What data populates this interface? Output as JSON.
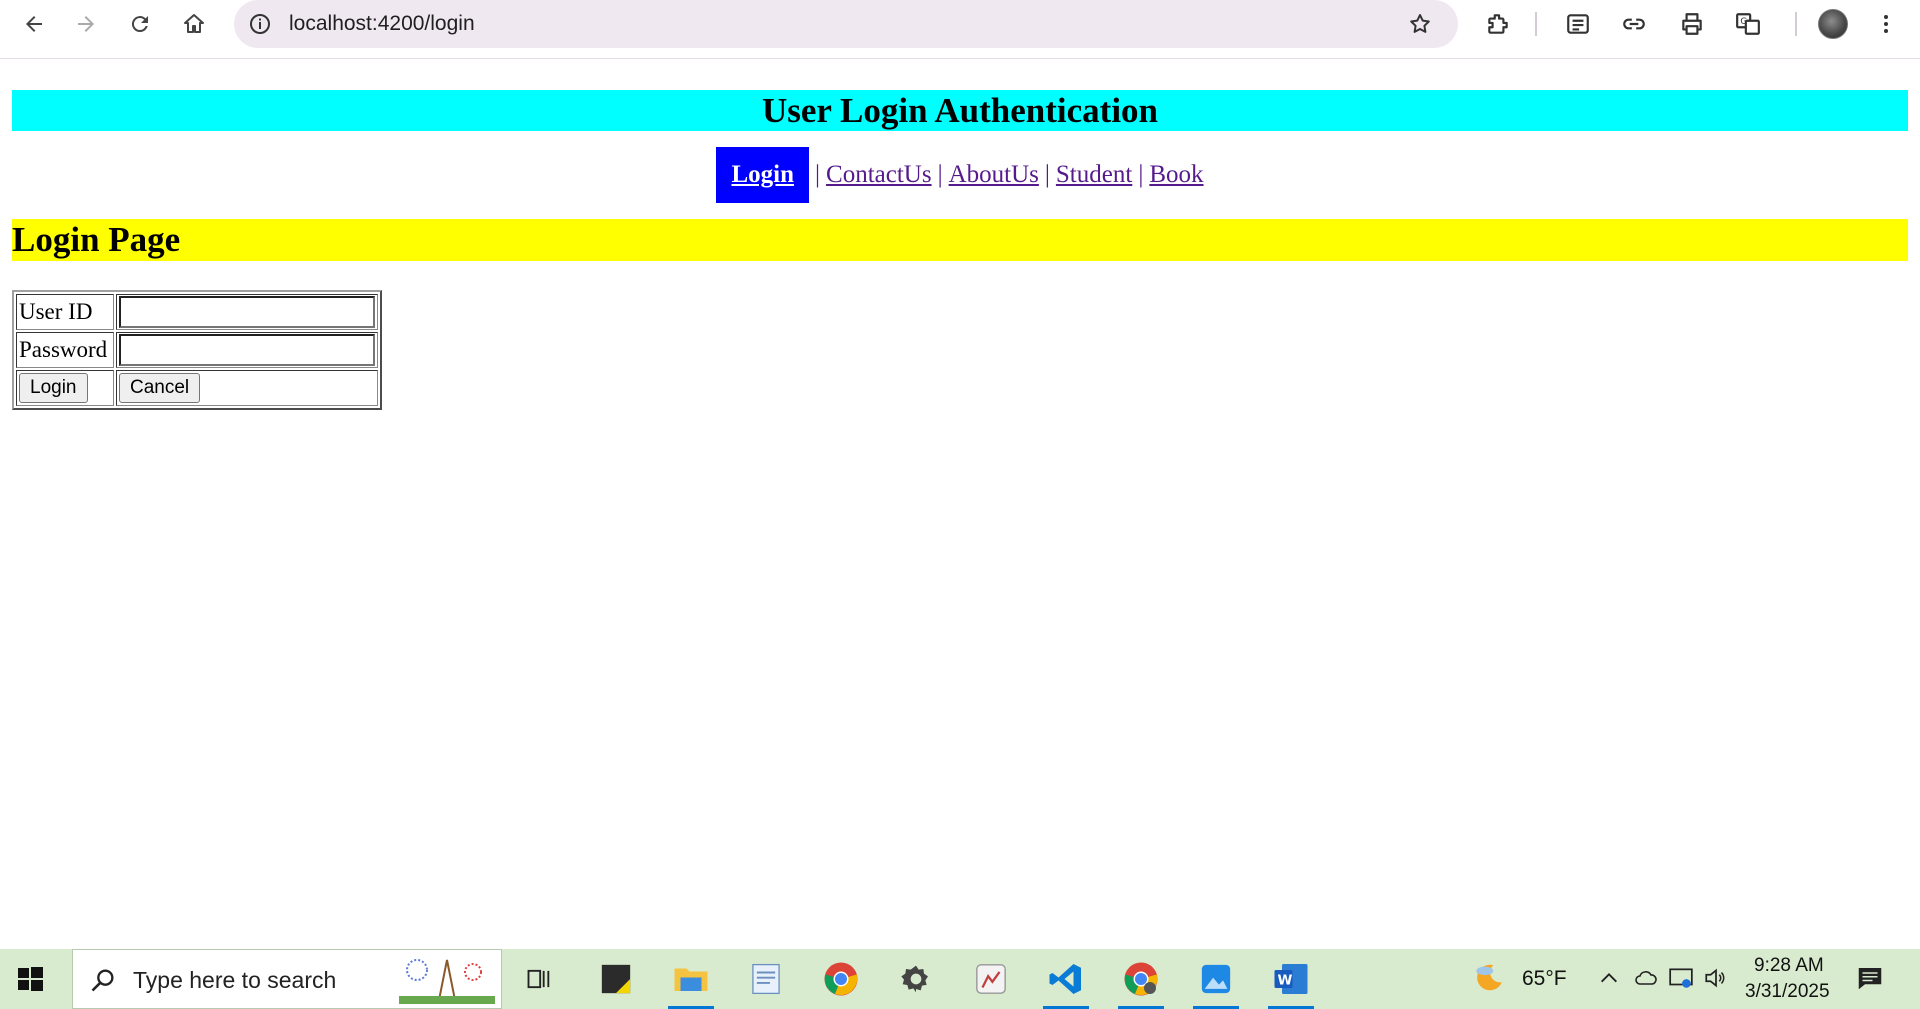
{
  "browser": {
    "url": "localhost:4200/login",
    "icons": [
      "back-arrow-icon",
      "forward-arrow-icon",
      "reload-icon",
      "home-icon",
      "site-info-icon",
      "bookmark-star-icon",
      "extensions-icon",
      "reading-list-icon",
      "copy-link-icon",
      "print-icon",
      "translate-icon",
      "profile-avatar",
      "more-menu-icon"
    ]
  },
  "page": {
    "title": "User Login Authentication",
    "nav": {
      "active": "Login",
      "links": [
        "ContactUs",
        "AboutUs",
        "Student",
        "Book"
      ],
      "separator": "|"
    },
    "section_title": "Login Page",
    "form": {
      "user_id_label": "User ID",
      "password_label": "Password",
      "user_id_value": "",
      "password_value": "",
      "login_button": "Login",
      "cancel_button": "Cancel"
    },
    "colors": {
      "header_bg": "#00ffff",
      "section_bg": "#ffff00",
      "active_nav_bg": "#0000ff",
      "link": "#551a8b"
    }
  },
  "taskbar": {
    "search_placeholder": "Type here to search",
    "weather": "65°F",
    "time": "9:28 AM",
    "date": "3/31/2025",
    "apps": [
      "task-view",
      "sticky-notes",
      "file-explorer",
      "notepad",
      "chrome",
      "settings",
      "paint",
      "vscode",
      "chrome-profile",
      "photos",
      "word"
    ]
  }
}
